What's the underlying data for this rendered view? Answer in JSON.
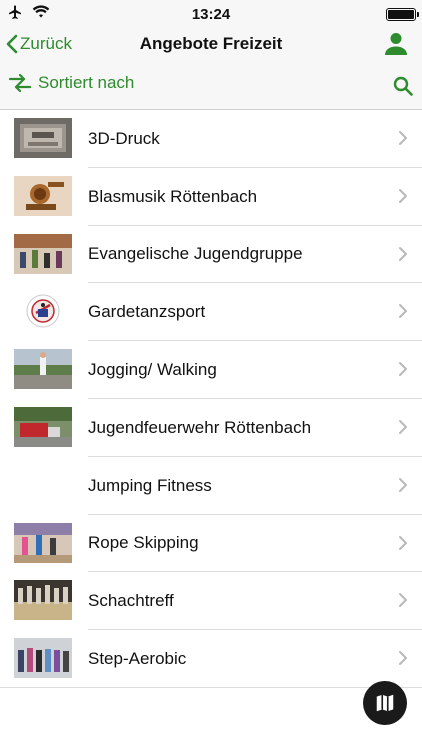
{
  "status_bar": {
    "time": "13:24"
  },
  "nav": {
    "back_label": "Zurück",
    "title": "Angebote Freizeit"
  },
  "toolbar": {
    "sort_label": "Sortiert nach"
  },
  "list_items": [
    {
      "label": "3D-Druck",
      "thumb": "3d-printer-photo"
    },
    {
      "label": "Blasmusik Röttenbach",
      "thumb": "brass-instrument-photo"
    },
    {
      "label": "Evangelische Jugendgruppe",
      "thumb": "youth-group-photo"
    },
    {
      "label": "Gardetanzsport",
      "thumb": "guard-dance-logo"
    },
    {
      "label": "Jogging/ Walking",
      "thumb": "jogging-photo"
    },
    {
      "label": "Jugendfeuerwehr Röttenbach",
      "thumb": "fire-truck-photo"
    },
    {
      "label": "Jumping Fitness",
      "thumb": ""
    },
    {
      "label": "Rope Skipping",
      "thumb": "rope-skipping-photo"
    },
    {
      "label": "Schachtreff",
      "thumb": "chess-pieces-photo"
    },
    {
      "label": "Step-Aerobic",
      "thumb": "aerobic-group-photo"
    }
  ],
  "colors": {
    "accent": "#2e8b2e",
    "bar_background": "#f7f7f7",
    "fab": "#1a1a1a"
  }
}
